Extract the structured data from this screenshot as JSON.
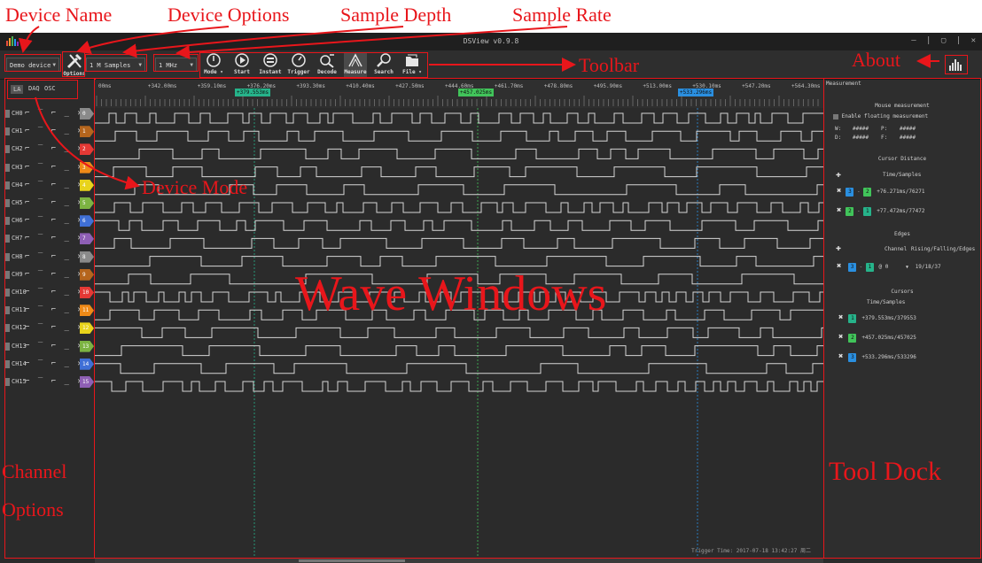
{
  "annotations": {
    "device_name": "Device Name",
    "device_options": "Device Options",
    "sample_depth": "Sample Depth",
    "sample_rate": "Sample Rate",
    "toolbar": "Toolbar",
    "about": "About",
    "device_mode": "Device Mode",
    "wave_windows": "Wave Windows",
    "channel_options_line1": "Channel",
    "channel_options_line2": "Options",
    "tool_dock": "Tool Dock"
  },
  "colors": {
    "annotation": "#e8161b",
    "background": "#2b2b2b"
  },
  "window": {
    "title": "DSView v0.9.8",
    "controls": "– | ▢ | ✕"
  },
  "toolbar": {
    "device": "Demo device",
    "options_label": "Options",
    "sample_depth": "1 M Samples",
    "sample_rate": "1 MHz",
    "buttons": [
      {
        "label": "Mode ▾",
        "icon": "mode-icon"
      },
      {
        "label": "Start",
        "icon": "start-icon"
      },
      {
        "label": "Instant",
        "icon": "instant-icon"
      },
      {
        "label": "Trigger",
        "icon": "trigger-icon"
      },
      {
        "label": "Decode",
        "icon": "decode-icon"
      },
      {
        "label": "Measure",
        "icon": "measure-icon"
      },
      {
        "label": "Search",
        "icon": "search-icon"
      },
      {
        "label": "File ▾",
        "icon": "file-icon"
      }
    ]
  },
  "modes": [
    "LA",
    "DAQ",
    "OSC"
  ],
  "channels": [
    {
      "name": "CH0",
      "num": "0",
      "color": "#8a8a8a"
    },
    {
      "name": "CH1",
      "num": "1",
      "color": "#b5651d"
    },
    {
      "name": "CH2",
      "num": "2",
      "color": "#e53935"
    },
    {
      "name": "CH3",
      "num": "3",
      "color": "#ef8a17"
    },
    {
      "name": "CH4",
      "num": "4",
      "color": "#e8d31b"
    },
    {
      "name": "CH5",
      "num": "5",
      "color": "#7cb342"
    },
    {
      "name": "CH6",
      "num": "6",
      "color": "#3f6fd6"
    },
    {
      "name": "CH7",
      "num": "7",
      "color": "#8e5fb5"
    },
    {
      "name": "CH8",
      "num": "8",
      "color": "#8a8a8a"
    },
    {
      "name": "CH9",
      "num": "9",
      "color": "#b5651d"
    },
    {
      "name": "CH10",
      "num": "10",
      "color": "#e53935"
    },
    {
      "name": "CH11",
      "num": "11",
      "color": "#ef8a17"
    },
    {
      "name": "CH12",
      "num": "12",
      "color": "#e8d31b"
    },
    {
      "name": "CH13",
      "num": "13",
      "color": "#7cb342"
    },
    {
      "name": "CH14",
      "num": "14",
      "color": "#3f6fd6"
    },
    {
      "name": "CH15",
      "num": "15",
      "color": "#8e5fb5"
    }
  ],
  "trigger_icons": "⌐ ‾ ⌐ _ ✕",
  "ruler": {
    "ticks": [
      "00ms",
      "+342.00ms",
      "+359.10ms",
      "+376.20ms",
      "+393.30ms",
      "+410.40ms",
      "+427.50ms",
      "+444.60ms",
      "+461.70ms",
      "+478.80ms",
      "+495.90ms",
      "+513.00ms",
      "+530.10ms",
      "+547.20ms",
      "+564.30ms"
    ],
    "cursors": [
      {
        "label": "+379.553ms",
        "num": "1",
        "color": "#26b38a"
      },
      {
        "label": "+457.025ms",
        "num": "2",
        "color": "#41c45a"
      },
      {
        "label": "+533.296ms",
        "num": "3",
        "color": "#2a8fe0"
      }
    ]
  },
  "dock": {
    "header": "Measurement",
    "mouse_title": "Mouse measurement",
    "enable_floating": "Enable floating measurement",
    "w_label": "W:",
    "w_val": "#####",
    "p_label": "P:",
    "p_val": "#####",
    "d_label": "D:",
    "d_val": "#####",
    "f_label": "F:",
    "f_val": "#####",
    "cursor_distance": "Cursor Distance",
    "time_samples": "Time/Samples",
    "distances": [
      {
        "a": "3",
        "ac": "#2a8fe0",
        "b": "2",
        "bc": "#41c45a",
        "value": "+76.271ms/76271"
      },
      {
        "a": "2",
        "ac": "#41c45a",
        "b": "1",
        "bc": "#26b38a",
        "value": "+77.472ms/77472"
      }
    ],
    "edges_title": "Edges",
    "edges_header_channel": "Channel",
    "edges_header_rfe": "Rising/Falling/Edges",
    "edge_row": {
      "a": "3",
      "ac": "#2a8fe0",
      "b": "1",
      "bc": "#26b38a",
      "channel": "0",
      "value": "19/18/37"
    },
    "cursors_title": "Cursors",
    "cursors_sub": "Time/Samples",
    "cursors": [
      {
        "num": "1",
        "color": "#26b38a",
        "value": "+379.553ms/379553"
      },
      {
        "num": "2",
        "color": "#41c45a",
        "value": "+457.025ms/457025"
      },
      {
        "num": "3",
        "color": "#2a8fe0",
        "value": "+533.296ms/533296"
      }
    ]
  },
  "status": {
    "trigger_time": "Trigger Time: 2017-07-18 13:42:27 周二"
  }
}
